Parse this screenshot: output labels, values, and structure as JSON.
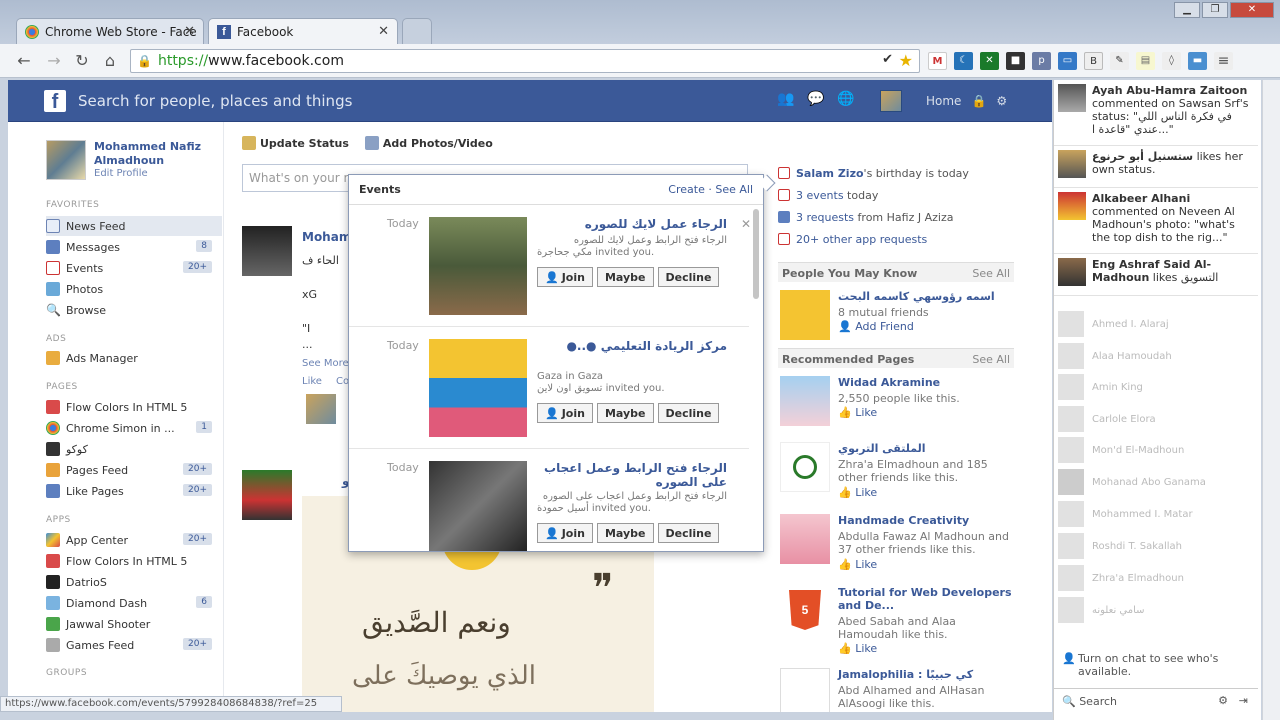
{
  "browser": {
    "tabs": [
      {
        "title": "Chrome Web Store - Face"
      },
      {
        "title": "Facebook"
      }
    ],
    "url_scheme": "https://",
    "url_rest": "www.facebook.com",
    "status_url": "https://www.facebook.com/events/579928408684838/?ref=25"
  },
  "fb": {
    "logo": "f",
    "search_placeholder": "Search for people, places and things",
    "home": "Home"
  },
  "profile": {
    "name": "Mohammed Nafiz Almadhoun",
    "edit": "Edit Profile"
  },
  "left": {
    "favorites_label": "FAVORITES",
    "favorites": [
      {
        "label": "News Feed",
        "count": ""
      },
      {
        "label": "Messages",
        "count": "8"
      },
      {
        "label": "Events",
        "count": "20+"
      },
      {
        "label": "Photos",
        "count": ""
      },
      {
        "label": "Browse",
        "count": ""
      }
    ],
    "ads_label": "ADS",
    "ads": [
      {
        "label": "Ads Manager"
      }
    ],
    "pages_label": "PAGES",
    "pages": [
      {
        "label": "Flow Colors In HTML 5",
        "count": ""
      },
      {
        "label": "Chrome Simon in ...",
        "count": "1"
      },
      {
        "label": "كوكو",
        "count": ""
      },
      {
        "label": "Pages Feed",
        "count": "20+"
      },
      {
        "label": "Like Pages",
        "count": "20+"
      }
    ],
    "apps_label": "APPS",
    "apps": [
      {
        "label": "App Center",
        "count": "20+"
      },
      {
        "label": "Flow Colors In HTML 5",
        "count": ""
      },
      {
        "label": "DatrioS",
        "count": ""
      },
      {
        "label": "Diamond Dash",
        "count": "6"
      },
      {
        "label": "Jawwal Shooter",
        "count": ""
      },
      {
        "label": "Games Feed",
        "count": "20+"
      }
    ],
    "groups_label": "GROUPS"
  },
  "composer": {
    "update_status": "Update Status",
    "add_photos": "Add Photos/Video",
    "placeholder": "What's on your m"
  },
  "story1": {
    "name": "Moham",
    "line1": "الحاء ف",
    "line2": "xG",
    "line3": "\"I",
    "see_more": "See More",
    "like": "Like",
    "comment": "Co"
  },
  "story2": {
    "name": "سامو",
    "q1": "ونعم الصَّديق",
    "q2": "الذي يوصيكَ على"
  },
  "right": {
    "birthday_name": "Salam Zizo",
    "birthday_rest": "'s birthday is today",
    "events_link": "3 events",
    "events_rest": " today",
    "requests_link": "3 requests",
    "requests_rest": " from Hafiz J Aziza",
    "app_requests": "20+ other app requests",
    "pymk_title": "People You May Know",
    "see_all": "See All",
    "pymk": {
      "name": "اسمه رؤوسهي كاسمه البحت",
      "mutual": "8 mutual friends",
      "action": "Add Friend"
    },
    "rec_title": "Recommended Pages",
    "pages": [
      {
        "name": "Widad Akramine",
        "sub": "2,550 people like this.",
        "action": "Like"
      },
      {
        "name": "الملتقى التربوي",
        "sub": "Zhra'a Elmadhoun and 185 other friends like this.",
        "action": "Like"
      },
      {
        "name": "Handmade Creativity",
        "sub": "Abdulla Fawaz Al Madhoun and 37 other friends like this.",
        "action": "Like"
      },
      {
        "name": "Tutorial for Web Developers and De...",
        "sub": "Abed Sabah and Alaa Hamoudah like this.",
        "action": "Like"
      },
      {
        "name": "Jamalophilia : كي حبيبًا",
        "sub": "Abd Alhamed and AlHasan AlAsoogi like this.",
        "action": ""
      }
    ]
  },
  "events": {
    "title": "Events",
    "create": "Create",
    "see_all": "See All",
    "items": [
      {
        "day": "Today",
        "title": "الرجاء عمل لايك للصوره",
        "sub1": "الرجاء فتح الرابط وعمل لايك للصوره",
        "sub2": "مكي جحاجرة invited you."
      },
      {
        "day": "Today",
        "title": "مركز الريادة التعليمي ●..●",
        "sub1": "Gaza in Gaza",
        "sub2": "تسويق اون لاين invited you."
      },
      {
        "day": "Today",
        "title": "الرجاء فتح الرابط وعمل اعجاب على الصوره",
        "sub1": "الرجاء فتح الرابط وعمل اعجاب على الصوره",
        "sub2": "أسيل حمودة invited you."
      }
    ],
    "join": "Join",
    "maybe": "Maybe",
    "decline": "Decline"
  },
  "ticker": [
    {
      "name": "Ayah Abu-Hamra Zaitoon",
      "text": " commented on Sawsan Srf's status: \"في فكرة الناس اللي عندي \"قاعدة ا...\""
    },
    {
      "name": "ستسنيل أبو حرنوع",
      "text": " likes her own status."
    },
    {
      "name": "Alkabeer Alhani",
      "text": " commented on Neveen Al Madhoun's photo: \"what's the top dish to the rig...\""
    },
    {
      "name": "Eng Ashraf Said Al-Madhoun",
      "text": " likes التسويق"
    }
  ],
  "chat": {
    "friends": [
      "Ahmed I. Alaraj",
      "Alaa Hamoudah",
      "Amin King",
      "Carlole Elora",
      "Mon'd El-Madhoun",
      "Mohanad Abo Ganama",
      "Mohammed I. Matar",
      "Roshdi T. Sakallah",
      "Zhra'a Elmadhoun",
      "سامي نعلونه"
    ],
    "off_text": "Turn on chat to see who's available.",
    "search": "Search"
  }
}
